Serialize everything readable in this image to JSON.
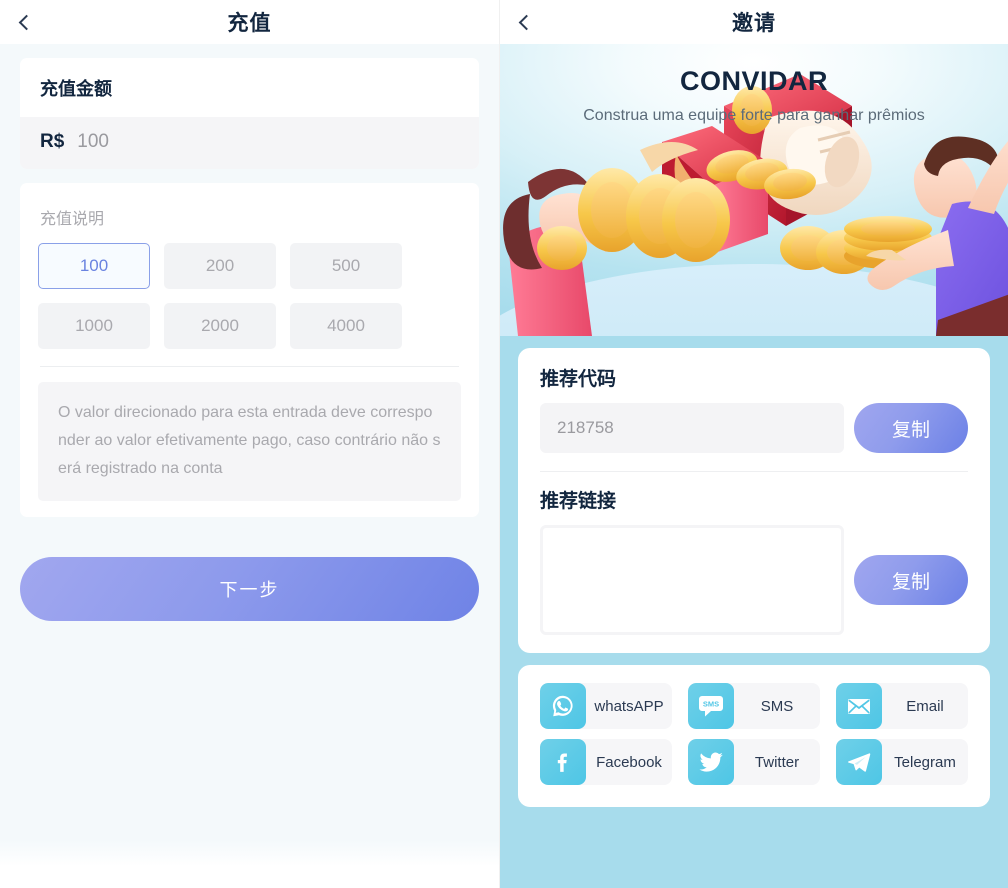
{
  "recharge": {
    "nav": {
      "back_icon": "chevron-left-icon",
      "title": "充值"
    },
    "amount_card": {
      "title": "充值金额",
      "currency": "R$",
      "value": "100"
    },
    "description_card": {
      "title": "充值说明",
      "chips": [
        "100",
        "200",
        "500",
        "1000",
        "2000",
        "4000"
      ],
      "selected_chip": "100",
      "note": "O valor direcionado para esta entrada deve corresponder ao valor efetivamente pago, caso contrário não será registrado na conta"
    },
    "next_button": "下一步"
  },
  "invite": {
    "nav": {
      "back_icon": "chevron-left-icon",
      "title": "邀请"
    },
    "hero": {
      "title": "CONVIDAR",
      "subtitle": "Construa uma equipe forte para ganhar prêmios",
      "art_name": "invite-illustration"
    },
    "referral_code": {
      "label": "推荐代码",
      "value": "218758",
      "copy_label": "复制"
    },
    "referral_link": {
      "label": "推荐链接",
      "value": "",
      "placeholder": "",
      "copy_label": "复制"
    },
    "share": [
      {
        "label": "whatsAPP",
        "icon": "whatsapp-icon"
      },
      {
        "label": "SMS",
        "icon": "sms-icon"
      },
      {
        "label": "Email",
        "icon": "email-icon"
      },
      {
        "label": "Facebook",
        "icon": "facebook-icon"
      },
      {
        "label": "Twitter",
        "icon": "twitter-icon"
      },
      {
        "label": "Telegram",
        "icon": "telegram-icon"
      }
    ]
  },
  "colors": {
    "accent_purple": "#7b8ce8",
    "accent_cyan": "#4ec6e6",
    "panel_blue": "#a7dcec",
    "text_dark": "#12263f",
    "text_muted": "#a9a9ae"
  }
}
